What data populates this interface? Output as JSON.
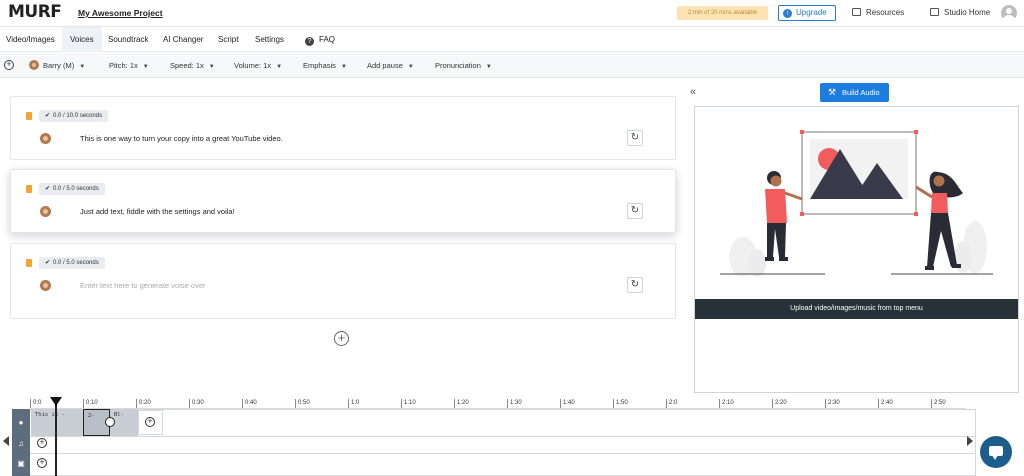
{
  "header": {
    "logo": "MURF",
    "project_title": "My Awesome Project",
    "minutes_badge": "2 min of 20 mins available",
    "upgrade_label": "Upgrade",
    "resources_label": "Resources",
    "studio_home_label": "Studio Home"
  },
  "tabs": [
    {
      "label": "Video/Images"
    },
    {
      "label": "Voices",
      "active": true
    },
    {
      "label": "Soundtrack"
    },
    {
      "label": "AI Changer"
    },
    {
      "label": "Script"
    },
    {
      "label": "Settings"
    },
    {
      "label": "FAQ"
    }
  ],
  "toolbar": {
    "voice": "Barry (M)",
    "pitch": "Pitch: 1x",
    "speed": "Speed: 1x",
    "volume": "Volume: 1x",
    "emphasis": "Emphasis",
    "add_pause": "Add pause",
    "pronunciation": "Pronunciation"
  },
  "blocks": [
    {
      "duration": "0.0 / 10.0 seconds",
      "text": "This is one way to turn your copy into a great YouTube video."
    },
    {
      "duration": "0.0 / 5.0 seconds",
      "text": "Just add text, fiddle with the settings and voila!"
    },
    {
      "duration": "0.0 / 5.0 seconds",
      "placeholder": "Enter text here to generate voise over"
    }
  ],
  "right_panel": {
    "build_audio_label": "Build Audio",
    "upload_message": "Upload video/images/music from top menu"
  },
  "timeline": {
    "ticks": [
      "0:0",
      "0:10",
      "0:20",
      "0:30",
      "0:40",
      "0:50",
      "1:0",
      "1:10",
      "1:20",
      "1:30",
      "1:40",
      "1:50",
      "2:0",
      "2:10",
      "2:20",
      "2:30",
      "2:40",
      "2:50"
    ],
    "clips": [
      "This is -",
      "2-",
      "Bl-"
    ]
  },
  "colors": {
    "primary": "#1c7ce0",
    "badge_bg": "#fde3b4",
    "trash": "#f2a33a",
    "illustration_red": "#f25c5c",
    "dark": "#263238"
  }
}
